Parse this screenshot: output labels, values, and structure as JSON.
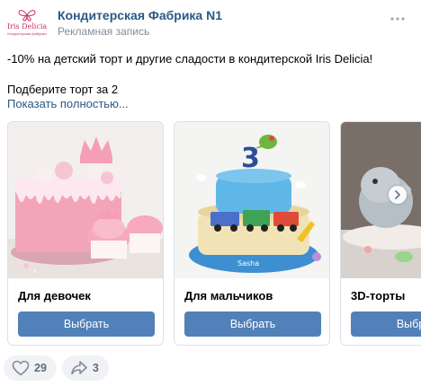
{
  "header": {
    "avatar_text": "Iris Delicia",
    "avatar_sub": "Кондитерская фабрика",
    "page_name": "Кондитерская Фабрика N1",
    "ad_label": "Рекламная запись",
    "more_icon": "more-horizontal-icon"
  },
  "post": {
    "text": "-10% на детский торт и другие сладости в кондитерской Iris Delicia!",
    "subtext": "Подберите торт за 2",
    "show_more": "Показать полностью..."
  },
  "carousel": {
    "cards": [
      {
        "title": "Для девочек",
        "button": "Выбрать"
      },
      {
        "title": "Для мальчиков",
        "button": "Выбрать"
      },
      {
        "title": "3D-торты",
        "button": "Выбрать"
      }
    ],
    "next_icon": "chevron-right-icon"
  },
  "actions": {
    "likes": "29",
    "shares": "3",
    "like_icon": "heart-icon",
    "share_icon": "share-arrow-icon"
  },
  "colors": {
    "link": "#2a5885",
    "button": "#5181b8",
    "muted": "#818c99"
  }
}
